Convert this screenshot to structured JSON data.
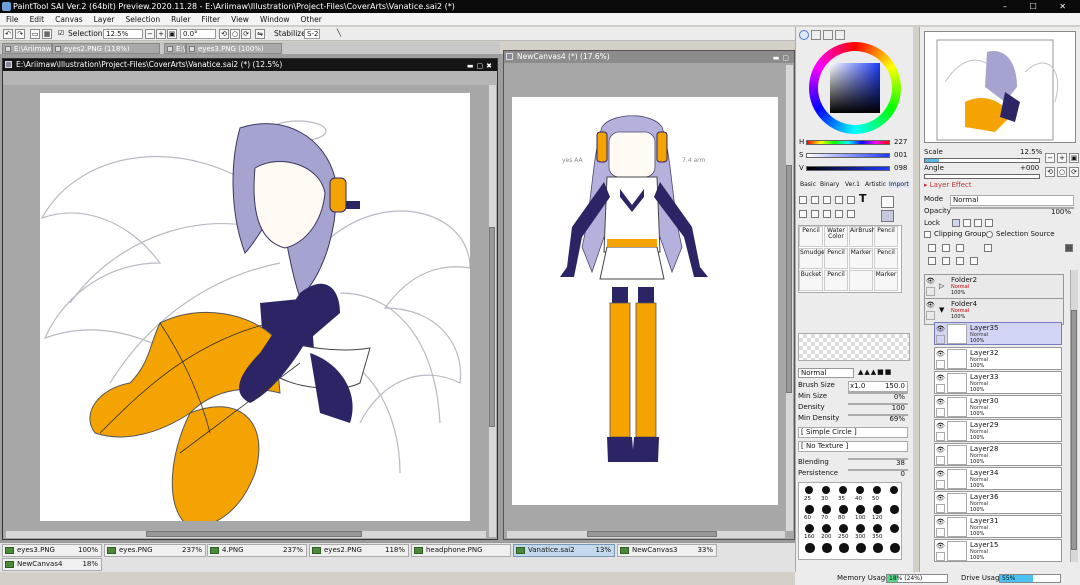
{
  "app": {
    "title": "PaintTool SAI Ver.2 (64bit) Preview.2020.11.28 - E:\\Ariimaw\\Illustration\\Project-Files\\CoverArts\\Vanatice.sai2 (*)"
  },
  "menu": [
    "File",
    "Edit",
    "Canvas",
    "Layer",
    "Selection",
    "Ruler",
    "Filter",
    "View",
    "Window",
    "Other"
  ],
  "toolbar": {
    "selection_label": "Selection",
    "zoom": "12.5%",
    "rotation": "0.0°",
    "stabilizer_label": "Stabilizer",
    "stabilizer_value": "S-2"
  },
  "doc_tabs": [
    "E:\\Ariimaw...",
    "eyes2.PNG (118%)",
    "E:\\A...",
    "eyes3.PNG (100%)"
  ],
  "windows": {
    "main_title": "E:\\Ariimaw\\Illustration\\Project-Files\\CoverArts\\Vanatice.sai2 (*) (12.5%)",
    "second_title": "NewCanvas4 (*) (17.6%)"
  },
  "canvas_notes": [
    "yes AA",
    "7.4 arm"
  ],
  "thumbnails": [
    {
      "name": "eyes3.PNG",
      "zoom": "100%"
    },
    {
      "name": "eyes.PNG",
      "zoom": "237%"
    },
    {
      "name": "4.PNG",
      "zoom": "237%"
    },
    {
      "name": "eyes2.PNG",
      "zoom": "118%"
    },
    {
      "name": "headphone.PNG",
      "zoom": ""
    },
    {
      "name": "Vanatice.sai2",
      "zoom": "13%"
    },
    {
      "name": "NewCanvas3",
      "zoom": "33%"
    },
    {
      "name": "NewCanvas4",
      "zoom": "18%"
    }
  ],
  "color": {
    "h_label": "H",
    "h_value": "227",
    "s_label": "S",
    "s_value": "001",
    "v_label": "V",
    "v_value": "098",
    "current_color": "#0b0b6e",
    "tabs": [
      "Basic",
      "Binary",
      "Ver.1",
      "Artistic",
      "Import"
    ]
  },
  "tools": {
    "text_tool": "T",
    "brushes": [
      {
        "name": "Pencil",
        "sub": ""
      },
      {
        "name": "Water Color",
        "sub": ""
      },
      {
        "name": "AirBrush",
        "sub": ""
      },
      {
        "name": "Pencil",
        "sub": ""
      },
      {
        "name": "Smudge",
        "sub": ""
      },
      {
        "name": "Pencil",
        "sub": ""
      },
      {
        "name": "Marker",
        "sub": ""
      },
      {
        "name": "Pencil",
        "sub": ""
      },
      {
        "name": "Bucket",
        "sub": ""
      },
      {
        "name": "Pencil",
        "sub": ""
      },
      {
        "name": "",
        "sub": ""
      },
      {
        "name": "Marker",
        "sub": ""
      }
    ]
  },
  "brush_settings": {
    "blend_mode": "Normal",
    "size_label": "Brush Size",
    "size_mult": "x1.0",
    "size_value": "150.0",
    "min_size_label": "Min Size",
    "min_size_value": "0%",
    "density_label": "Density",
    "density_value": "100",
    "min_density_label": "Min Density",
    "min_density_value": "69%",
    "shape": "[ Simple Circle ]",
    "texture": "[ No Texture ]",
    "blending_label": "Blending",
    "blending_value": "38",
    "persistence_label": "Persistence",
    "persistence_value": "0",
    "sizes": [
      "25",
      "30",
      "35",
      "40",
      "50",
      "60",
      "70",
      "80",
      "100",
      "120",
      "160",
      "200",
      "250",
      "300",
      "350"
    ]
  },
  "navigator": {
    "scale_label": "Scale",
    "scale_value": "12.5%",
    "angle_label": "Angle",
    "angle_value": "+000"
  },
  "layer_panel": {
    "effect_label": "Layer Effect",
    "mode_label": "Mode",
    "mode_value": "Normal",
    "opacity_label": "Opacity",
    "opacity_value": "100%",
    "lock_label": "Lock",
    "clipping_label": "Clipping Group",
    "selection_source_label": "Selection Source",
    "layers": [
      {
        "name": "Folder2",
        "mode": "Normal",
        "opacity": "100%"
      },
      {
        "name": "Folder4",
        "mode": "Normal",
        "opacity": "100%"
      },
      {
        "name": "Layer35",
        "mode": "Normal",
        "opacity": "100%"
      },
      {
        "name": "Layer32",
        "mode": "Normal",
        "opacity": "100%"
      },
      {
        "name": "Layer33",
        "mode": "Normal",
        "opacity": "100%"
      },
      {
        "name": "Layer30",
        "mode": "Normal",
        "opacity": "100%"
      },
      {
        "name": "Layer29",
        "mode": "Normal",
        "opacity": "100%"
      },
      {
        "name": "Layer28",
        "mode": "Normal",
        "opacity": "100%"
      },
      {
        "name": "Layer34",
        "mode": "Normal",
        "opacity": "100%"
      },
      {
        "name": "Layer36",
        "mode": "Normal",
        "opacity": "100%"
      },
      {
        "name": "Layer31",
        "mode": "Normal",
        "opacity": "100%"
      },
      {
        "name": "Layer15",
        "mode": "Normal",
        "opacity": "100%"
      }
    ]
  },
  "status": {
    "memory_label": "Memory Usage",
    "memory_value": "18% (24%)",
    "memory_fraction": 0.18,
    "drive_label": "Drive Usage",
    "drive_value": "55%",
    "drive_fraction": 0.55
  },
  "colors": {
    "accent": "#f5a300",
    "navy": "#2b2566",
    "hair": "#9b98cc"
  }
}
